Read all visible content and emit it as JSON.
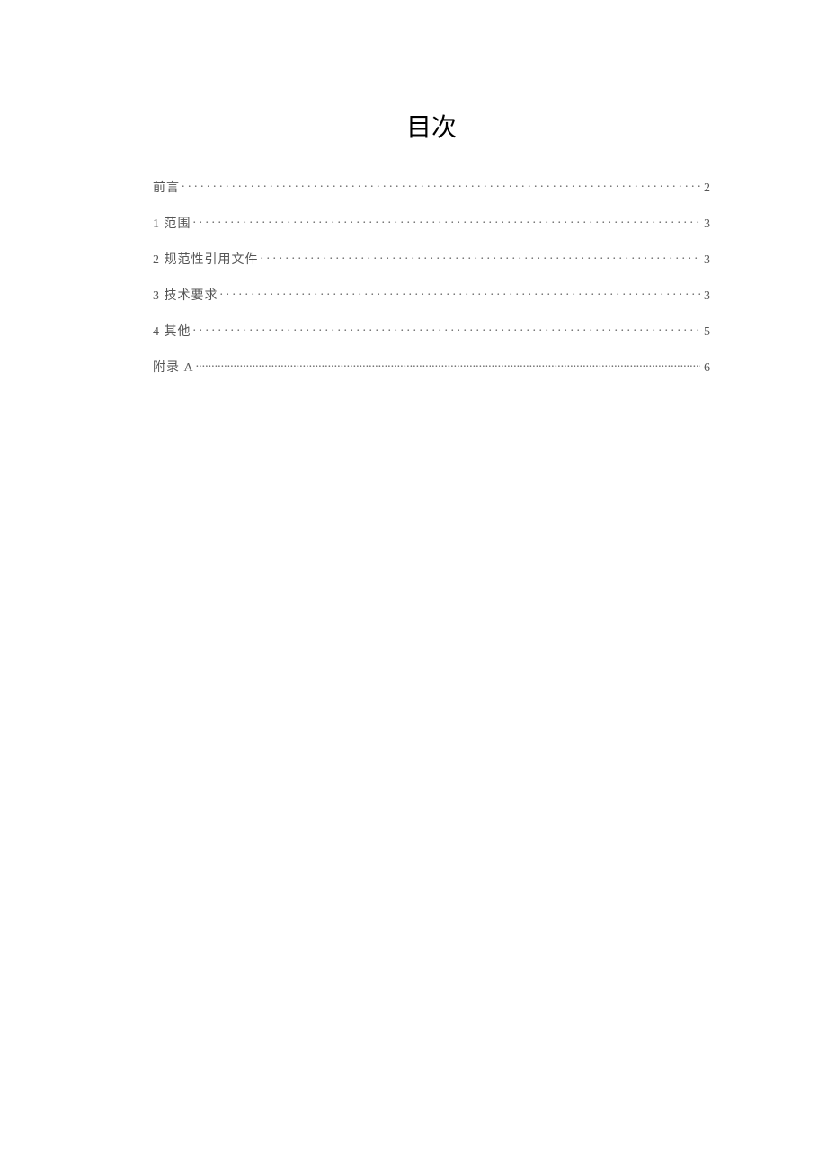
{
  "title": "目次",
  "toc": {
    "entries": [
      {
        "label": "前言",
        "page": "2",
        "dense": false
      },
      {
        "label": "1 范围",
        "page": "3",
        "dense": false
      },
      {
        "label": "2 规范性引用文件",
        "page": "3",
        "dense": false
      },
      {
        "label": "3 技术要求",
        "page": "3",
        "dense": false
      },
      {
        "label": "4 其他",
        "page": "5",
        "dense": false
      },
      {
        "label": "附录 A",
        "page": "6",
        "dense": true
      }
    ]
  }
}
